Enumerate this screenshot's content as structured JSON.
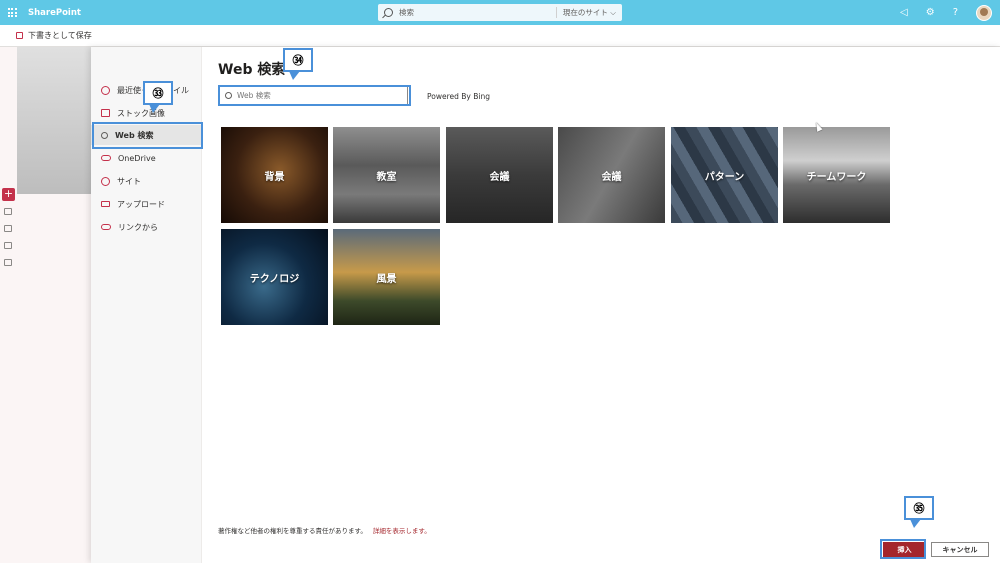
{
  "suitebar": {
    "brand": "SharePoint",
    "search_placeholder": "検索",
    "search_scope": "現在のサイト",
    "icons": [
      "waffle-icon",
      "megaphone-icon",
      "gear-icon",
      "help-icon",
      "avatar"
    ]
  },
  "commandbar": {
    "save_draft_label": "下書きとして保存"
  },
  "nav": {
    "items": [
      {
        "label": "最近使ったファイル",
        "icon": "clock-icon"
      },
      {
        "label": "ストック画像",
        "icon": "image-icon"
      },
      {
        "label": "Web 検索",
        "icon": "search-icon",
        "active": true
      },
      {
        "label": "OneDrive",
        "icon": "cloud-icon"
      },
      {
        "label": "サイト",
        "icon": "globe-icon"
      },
      {
        "label": "アップロード",
        "icon": "laptop-icon"
      },
      {
        "label": "リンクから",
        "icon": "link-icon"
      }
    ]
  },
  "content": {
    "title": "Web 検索",
    "search_placeholder": "Web 検索",
    "powered_by": "Powered By Bing",
    "tiles": [
      "背景",
      "教室",
      "会議",
      "会議",
      "パターン",
      "チームワーク",
      "テクノロジ",
      "風景"
    ],
    "legal_text": "著作権など他者の権利を尊重する責任があります。",
    "legal_link": "詳細を表示します。",
    "insert_label": "挿入",
    "cancel_label": "キャンセル"
  },
  "callouts": {
    "c33": "㉝",
    "c34": "㉞",
    "c35": "㉟"
  },
  "colors": {
    "suitebar": "#5fc8e6",
    "accent": "#a4262c",
    "highlight": "#4a90d9"
  }
}
